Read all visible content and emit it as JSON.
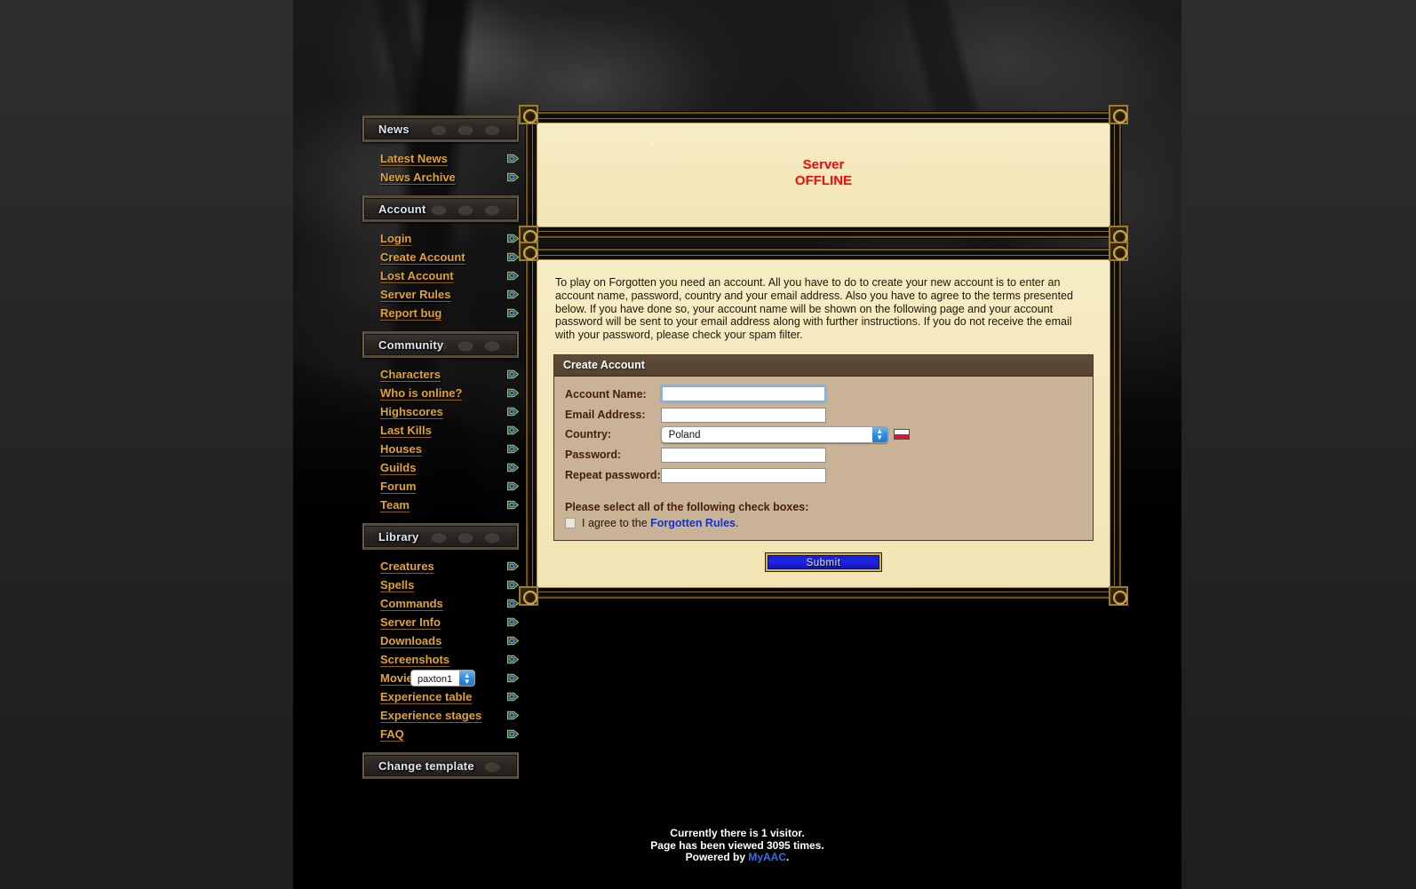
{
  "sidebar": {
    "sections": [
      {
        "header": "News",
        "items": [
          {
            "label": "Latest News",
            "icon": "arrow-bullet-icon"
          },
          {
            "label": "News Archive",
            "icon": "arrow-bullet-icon"
          }
        ]
      },
      {
        "header": "Account",
        "items": [
          {
            "label": "Login",
            "icon": "arrow-bullet-icon"
          },
          {
            "label": "Create Account",
            "icon": "arrow-bullet-icon"
          },
          {
            "label": "Lost Account",
            "icon": "arrow-bullet-icon"
          },
          {
            "label": "Server Rules",
            "icon": "arrow-bullet-icon"
          },
          {
            "label": "Report bug",
            "icon": "arrow-bullet-icon"
          }
        ]
      },
      {
        "header": "Community",
        "items": [
          {
            "label": "Characters",
            "icon": "arrow-bullet-icon"
          },
          {
            "label": "Who is online?",
            "icon": "arrow-bullet-icon"
          },
          {
            "label": "Highscores",
            "icon": "arrow-bullet-icon"
          },
          {
            "label": "Last Kills",
            "icon": "arrow-bullet-icon"
          },
          {
            "label": "Houses",
            "icon": "arrow-bullet-icon"
          },
          {
            "label": "Guilds",
            "icon": "arrow-bullet-icon"
          },
          {
            "label": "Forum",
            "icon": "arrow-bullet-icon"
          },
          {
            "label": "Team",
            "icon": "arrow-bullet-icon"
          }
        ]
      },
      {
        "header": "Library",
        "items": [
          {
            "label": "Creatures",
            "icon": "arrow-bullet-icon"
          },
          {
            "label": "Spells",
            "icon": "arrow-bullet-icon"
          },
          {
            "label": "Commands",
            "icon": "arrow-bullet-icon"
          },
          {
            "label": "Server Info",
            "icon": "arrow-bullet-icon"
          },
          {
            "label": "Downloads",
            "icon": "arrow-bullet-icon"
          },
          {
            "label": "Screenshots",
            "icon": "arrow-bullet-icon"
          },
          {
            "label": "Movies",
            "icon": "arrow-bullet-icon"
          },
          {
            "label": "Experience table",
            "icon": "arrow-bullet-icon"
          },
          {
            "label": "Experience stages",
            "icon": "arrow-bullet-icon"
          },
          {
            "label": "FAQ",
            "icon": "arrow-bullet-icon"
          }
        ]
      }
    ],
    "change_template": {
      "header": "Change template",
      "selected": "paxton1"
    }
  },
  "server_status": {
    "line1": "Server",
    "line2": "OFFLINE",
    "color": "#e81414"
  },
  "main": {
    "intro": "To play on Forgotten you need an account. All you have to do to create your new account is to enter an account name, password, country and your email address. Also you have to agree to the terms presented below. If you have done so, your account name will be shown on the following page and your account password will be sent to your email address along with further instructions. If you do not receive the email with your password, please check your spam filter.",
    "panel_title": "Create Account",
    "fields": {
      "account_name": {
        "label": "Account Name:",
        "value": "",
        "placeholder": ""
      },
      "email_address": {
        "label": "Email Address:",
        "value": "",
        "placeholder": ""
      },
      "country": {
        "label": "Country:",
        "value": "Poland",
        "flag": "flag-poland-icon"
      },
      "password": {
        "label": "Password:",
        "value": "",
        "placeholder": ""
      },
      "repeat_password": {
        "label": "Repeat password:",
        "value": "",
        "placeholder": ""
      }
    },
    "checks_title": "Please select all of the following check boxes:",
    "agree_prefix": "I agree to the ",
    "agree_link": "Forgotten Rules",
    "agree_suffix": ".",
    "submit_label": "Submit"
  },
  "footer": {
    "visitors": "Currently there is 1 visitor.",
    "views": "Page has been viewed 3095 times.",
    "powered_prefix": "Powered by ",
    "powered_link": "MyAAC",
    "powered_suffix": "."
  }
}
